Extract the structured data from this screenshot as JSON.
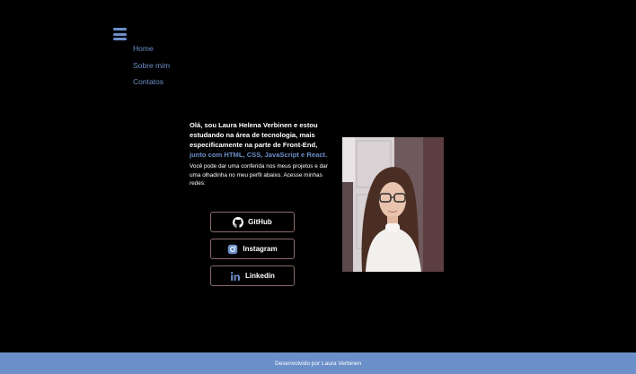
{
  "nav": {
    "menu_icon": "hamburger-menu-icon",
    "items": [
      {
        "label": "Home"
      },
      {
        "label": "Sobre mim"
      },
      {
        "label": "Contatos"
      }
    ]
  },
  "intro": {
    "lead_part1": "Olá, sou Laura Helena Verbinen e estou estudando na área de tecnologia, mais especificamente na parte de Front-End, ",
    "lead_highlight": "junto com HTML, CSS, JavaScript e React.",
    "sub": "Você pode dar uma conferida nos meus projetos e dar uma olhadinha no meu perfil abaixo. Acesse minhas redes:"
  },
  "social": [
    {
      "label": "GitHub",
      "icon": "github-icon"
    },
    {
      "label": "Instagram",
      "icon": "instagram-icon"
    },
    {
      "label": "Linkedin",
      "icon": "linkedin-icon"
    }
  ],
  "footer": {
    "text": "Desenvolvido por Laura Verbinen"
  },
  "colors": {
    "background": "#000000",
    "accent": "#6b8fc8",
    "button_border": "#8a6a6a"
  }
}
